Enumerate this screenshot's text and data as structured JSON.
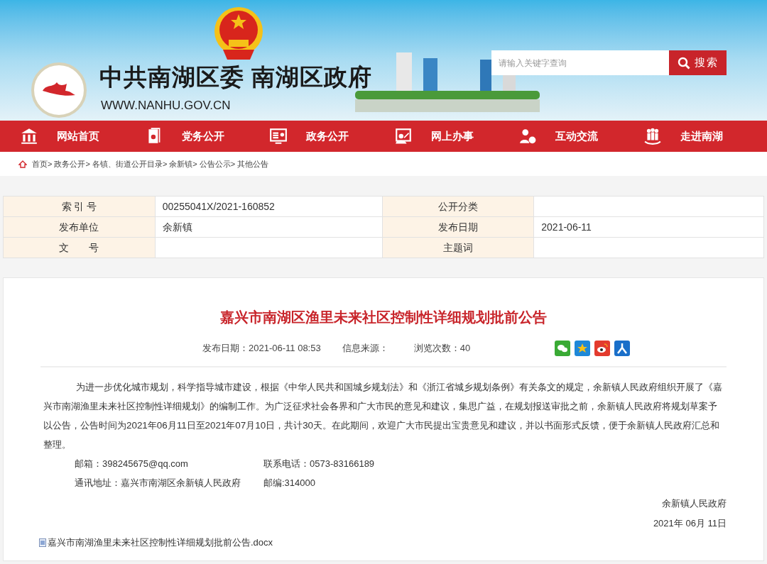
{
  "header": {
    "title": "中共南湖区委 南湖区政府",
    "url": "WWW.NANHU.GOV.CN",
    "search": {
      "placeholder": "请输入关键字查询",
      "button": "搜索"
    }
  },
  "nav": [
    {
      "label": "网站首页",
      "kind": "building"
    },
    {
      "label": "党务公开",
      "kind": "book"
    },
    {
      "label": "政务公开",
      "kind": "monitor"
    },
    {
      "label": "网上办事",
      "kind": "person-board"
    },
    {
      "label": "互动交流",
      "kind": "person-chat"
    },
    {
      "label": "走进南湖",
      "kind": "people"
    }
  ],
  "breadcrumb": [
    "首页>",
    "政务公开>",
    "各镇、街道公开目录>",
    "余新镇>",
    "公告公示>",
    "其他公告"
  ],
  "info_table": [
    [
      {
        "label": "索 引 号",
        "value": "00255041X/2021-160852"
      },
      {
        "label": "公开分类"
      }
    ],
    [
      {
        "label": "发布单位",
        "value": "余新镇"
      },
      {
        "label": "发布日期",
        "value": "2021-06-11"
      }
    ],
    [
      {
        "label": "文　　号"
      },
      {
        "label": "主题词"
      }
    ]
  ],
  "article": {
    "title": "嘉兴市南湖区渔里未来社区控制性详细规划批前公告",
    "meta": [
      "发布日期：2021-06-11 08:53",
      "信息来源：",
      "浏览次数：40"
    ],
    "share": [
      {
        "kind": "wechat",
        "color": "#3aaa35"
      },
      {
        "kind": "star",
        "color": "#1e88d8"
      },
      {
        "kind": "weibo",
        "color": "#e33b2e"
      },
      {
        "kind": "renren",
        "color": "#1a6fc9"
      }
    ],
    "body": "为进一步优化城市规划，科学指导城市建设，根据《中华人民共和国城乡规划法》和《浙江省城乡规划条例》有关条文的规定，余新镇人民政府组织开展了《嘉兴市南湖渔里未来社区控制性详细规划》的编制工作。为广泛征求社会各界和广大市民的意见和建议，集思广益，在规划报送审批之前，余新镇人民政府将规划草案予以公告，公告时间为2021年06月11日至2021年07月10日，共计30天。在此期间，欢迎广大市民提出宝贵意见和建议，并以书面形式反馈，便于余新镇人民政府汇总和整理。",
    "contacts": [
      [
        "邮箱：398245675@qq.com",
        "联系电话：0573-83166189"
      ],
      [
        "通讯地址：嘉兴市南湖区余新镇人民政府",
        "邮编:314000"
      ]
    ],
    "signature": "余新镇人民政府",
    "date": "2021年 06月 11日",
    "attachment": "嘉兴市南湖渔里未来社区控制性详细规划批前公告.docx"
  }
}
